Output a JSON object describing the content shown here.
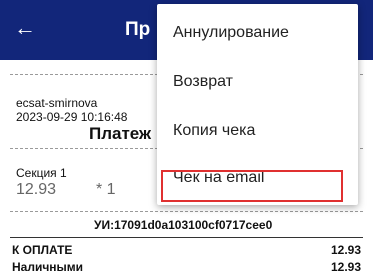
{
  "appbar": {
    "title": "Пр"
  },
  "receipt": {
    "cashier": "ecsat-smirnova",
    "datetime": "2023-09-29 10:16:48",
    "heading": "Платеж",
    "section": "Секция 1",
    "item_price": "12.93",
    "item_qty": "* 1",
    "ui_code": "УИ:17091d0a103100cf0717cee0",
    "total_label": "К ОПЛАТЕ",
    "total_value": "12.93",
    "cash_label": "Наличными",
    "cash_value": "12.93"
  },
  "menu": {
    "items": [
      {
        "label": "Аннулирование"
      },
      {
        "label": "Возврат"
      },
      {
        "label": "Копия чека"
      },
      {
        "label": "Чек на email"
      }
    ],
    "highlighted_index": 3
  }
}
